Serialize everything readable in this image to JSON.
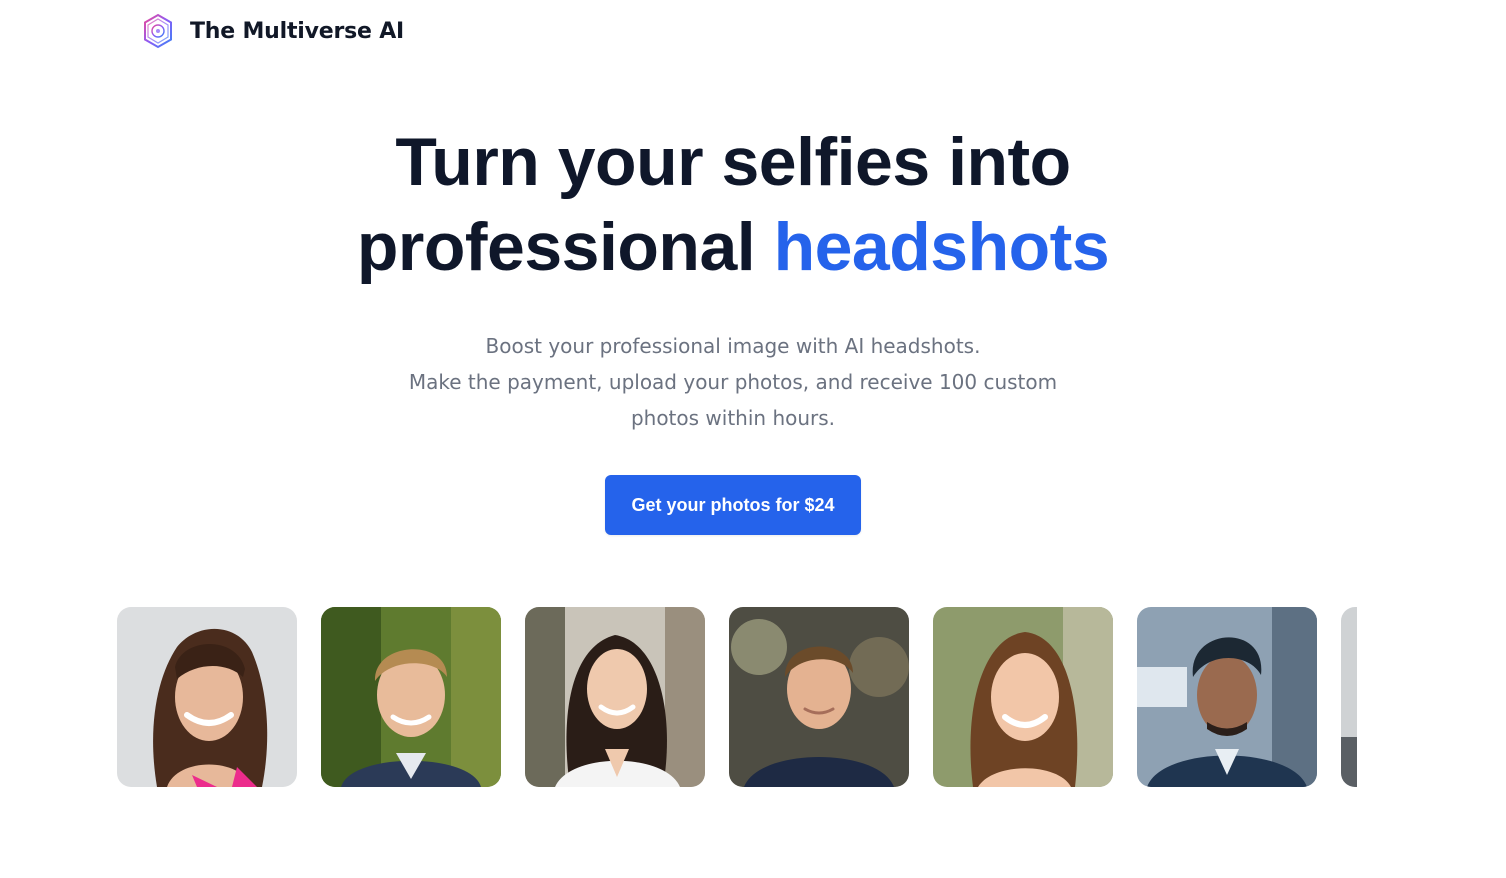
{
  "header": {
    "brand": "The Multiverse AI",
    "logo_icon": "multiverse-logo-icon"
  },
  "hero": {
    "headline_line1": "Turn your selfies into",
    "headline_line2_plain": "professional",
    "headline_line2_accent": "headshots",
    "subtitle_line1": "Boost your professional image with AI headshots.",
    "subtitle_line2": "Make the payment, upload your photos, and receive 100 custom photos within hours."
  },
  "cta": {
    "label": "Get your photos for $24"
  },
  "colors": {
    "accent": "#2563eb",
    "heading": "#0f172a",
    "muted": "#6b7280"
  },
  "gallery": {
    "photos": [
      "headshot-woman-bangs-pink-top",
      "headshot-man-blond-suit",
      "headshot-woman-white-blouse",
      "headshot-man-navy-shirt",
      "headshot-woman-brown-hair-smiling",
      "headshot-man-dark-suit",
      "headshot-partial"
    ]
  }
}
